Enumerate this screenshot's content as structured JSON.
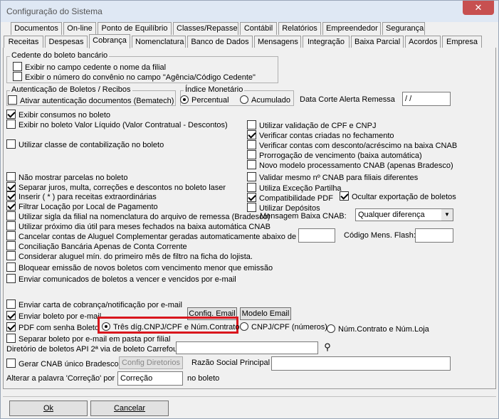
{
  "window": {
    "title": "Configuração do Sistema",
    "close": "✕"
  },
  "tabs_row1": [
    "Documentos",
    "On-line",
    "Ponto de Equilíbrio",
    "Classes/Repasse",
    "Contábil",
    "Relatórios",
    "Empreendedor",
    "Segurança"
  ],
  "tabs_row2": [
    "Receitas",
    "Despesas",
    "Cobrança",
    "Nomenclatura",
    "Banco de Dados",
    "Mensagens",
    "Integração",
    "Baixa Parcial",
    "Acordos",
    "Empresa"
  ],
  "cedente": {
    "title": "Cedente do boleto bancário",
    "opt1": "Exibir no campo cedente o nome da filial",
    "opt2": "Exibir o número do convênio no campo \"Agência/Código Cedente\""
  },
  "autenticacao": {
    "title": "Autenticação de Boletos / Recibos",
    "opt": "Ativar autenticação documentos (Bematech)"
  },
  "indice": {
    "title": "Índice Monetário",
    "percentual": "Percentual",
    "acumulado": "Acumulado"
  },
  "data_corte": {
    "label": "Data Corte Alerta Remessa",
    "value": " /  /"
  },
  "left": {
    "exibir_consumos": "Exibir consumos no boleto",
    "exibir_valor_liquido": "Exibir no boleto Valor Líquido (Valor Contratual - Descontos)",
    "utilizar_classe": "Utilizar classe de contabilização no boleto",
    "nao_mostrar_parcelas": "Não mostrar parcelas no boleto",
    "separar_juros": "Separar juros, multa, correções e descontos no boleto laser",
    "inserir": "Inserir ( * ) para receitas extraordinárias",
    "filtrar": "Filtrar Locação por Local de Pagamento",
    "sigla": "Utilizar sigla da filial na nomenclatura do arquivo de remessa (Bradesco)",
    "proximo_dia": "Utilizar próximo dia útil para meses fechados na baixa automática CNAB",
    "cancelar": "Cancelar contas de Aluguel Complementar geradas automaticamente abaixo de R$",
    "conciliacao": "Conciliação Bancária Apenas de Conta Corrente",
    "considerar": "Considerar aluguel mín. do primeiro mês de filtro na ficha do lojista.",
    "bloquear": "Bloquear emissão de novos boletos com vencimento menor que emissão",
    "enviar_comunicados": "Enviar comunicados de boletos a vencer e vencidos por e-mail",
    "enviar_carta": "Enviar carta de cobrança/notificação por e-mail",
    "enviar_boleto": "Enviar boleto por e-mail",
    "pdf_senha": "PDF com senha Boleto",
    "separar_boleto": "Separar boleto por e-mail em pasta por filial"
  },
  "right": {
    "validacao_cpf": "Utilizar validação de CPF e CNPJ",
    "verificar_contas": "Verificar contas criadas no fechamento",
    "verificar_desconto": "Verificar contas com desconto/acréscimo na baixa CNAB",
    "prorrogacao": "Prorrogação de vencimento (baixa automática)",
    "novo_modelo": "Novo modelo processamento CNAB (apenas Bradesco)",
    "validar_cnab": "Validar mesmo nº CNAB para filiais diferentes",
    "excecao": "Utiliza Exceção Partilha",
    "compat_pdf": "Compatibilidade PDF",
    "ocultar": "Ocultar exportação de boletos",
    "depositos": "Utilizar Depósitos",
    "mensagem_baixa_label": "Mensagem Baixa CNAB:",
    "mensagem_baixa_value": "Qualquer diferença",
    "codigo_flash": "Código Mens. Flash:"
  },
  "buttons": {
    "config_email": "Config. Email",
    "modelo_email": "Modelo Email",
    "config_diretorios": "Config Diretorios",
    "ok": "Ok",
    "cancelar": "Cancelar"
  },
  "pdf_options": {
    "tres_dig": "Três díg.CNPJ/CPF e Núm.Contrato",
    "cnpj": "CNPJ/CPF (números)",
    "num_contrato": "Núm.Contrato e Núm.Loja"
  },
  "diretorio": {
    "label": "Diretório de boletos API 2ª via de boleto Carrefour",
    "value": ""
  },
  "gerar_cnab": "Gerar CNAB único Bradesco",
  "razao_social": "Razão Social Principal",
  "correcao": {
    "label": "Alterar a palavra 'Correção' por",
    "value": "Correção",
    "suffix": "no boleto"
  }
}
